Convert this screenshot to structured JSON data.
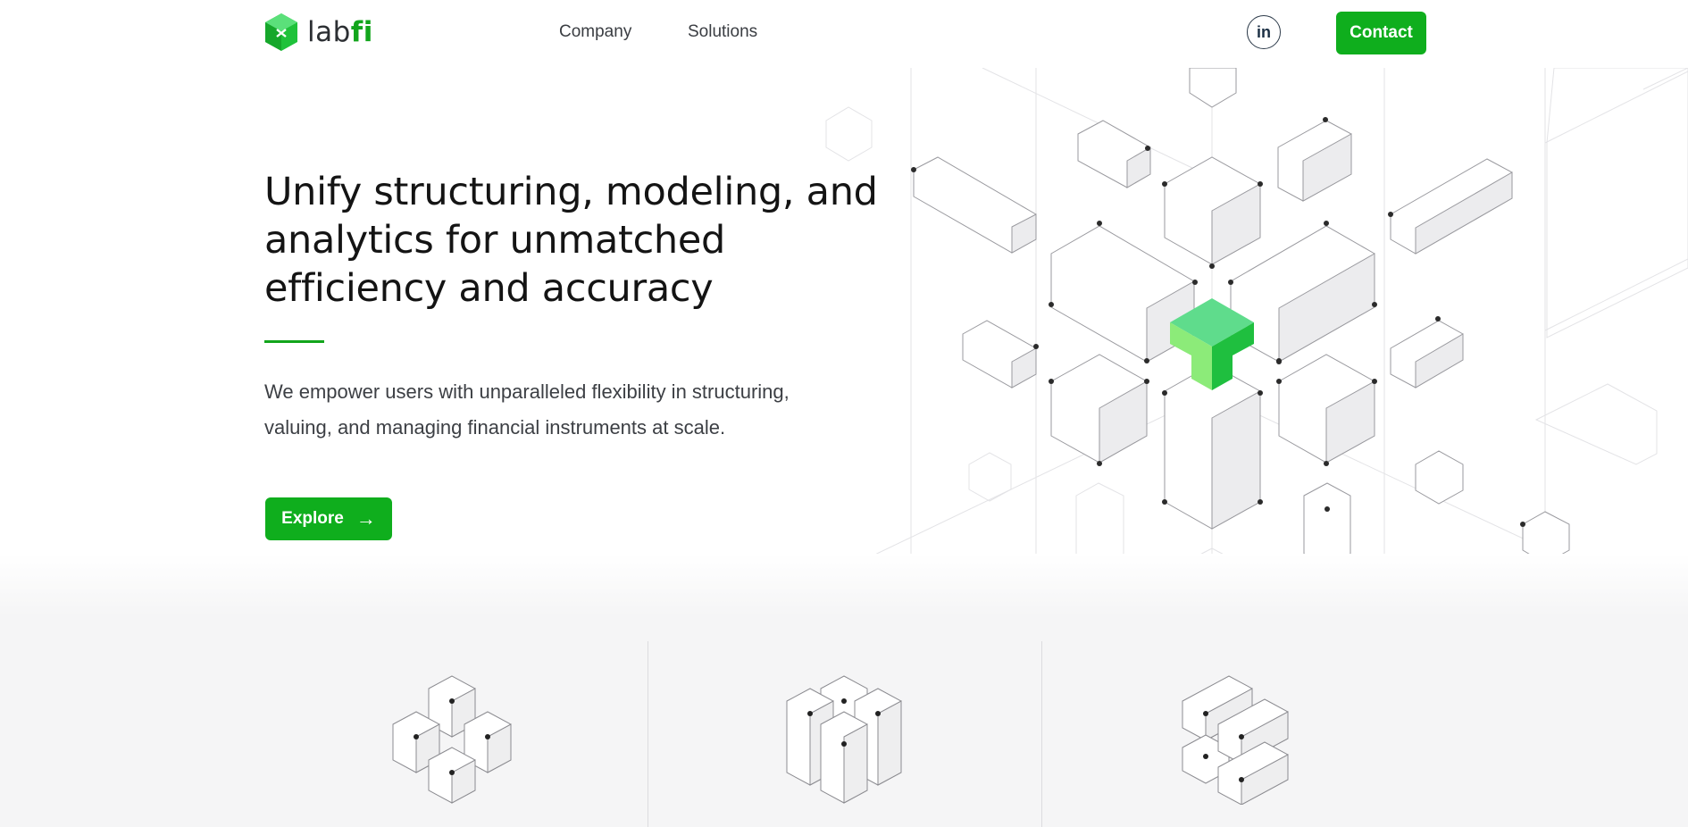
{
  "header": {
    "logo": {
      "text_prefix": "lab",
      "text_accent": "fi",
      "icon": "cube-hex-logo-icon"
    },
    "nav": [
      {
        "label": "Company"
      },
      {
        "label": "Solutions"
      }
    ],
    "social": {
      "label": "in",
      "icon": "linkedin-icon"
    },
    "contact_label": "Contact"
  },
  "hero": {
    "title": "Unify structuring, modeling, and analytics for unmatched efficiency and accuracy",
    "description": "We empower users with unparalleled flexibility in structuring, valuing, and managing financial instruments at scale.",
    "explore_label": "Explore",
    "explore_icon": "arrow-right-icon"
  },
  "colors": {
    "brand_green": "#0fae1d",
    "text": "#141414",
    "band_gray": "#f5f5f6"
  },
  "features": {
    "icons": [
      "cube-cluster-icon",
      "cube-columns-icon",
      "cube-stack-icon"
    ]
  }
}
